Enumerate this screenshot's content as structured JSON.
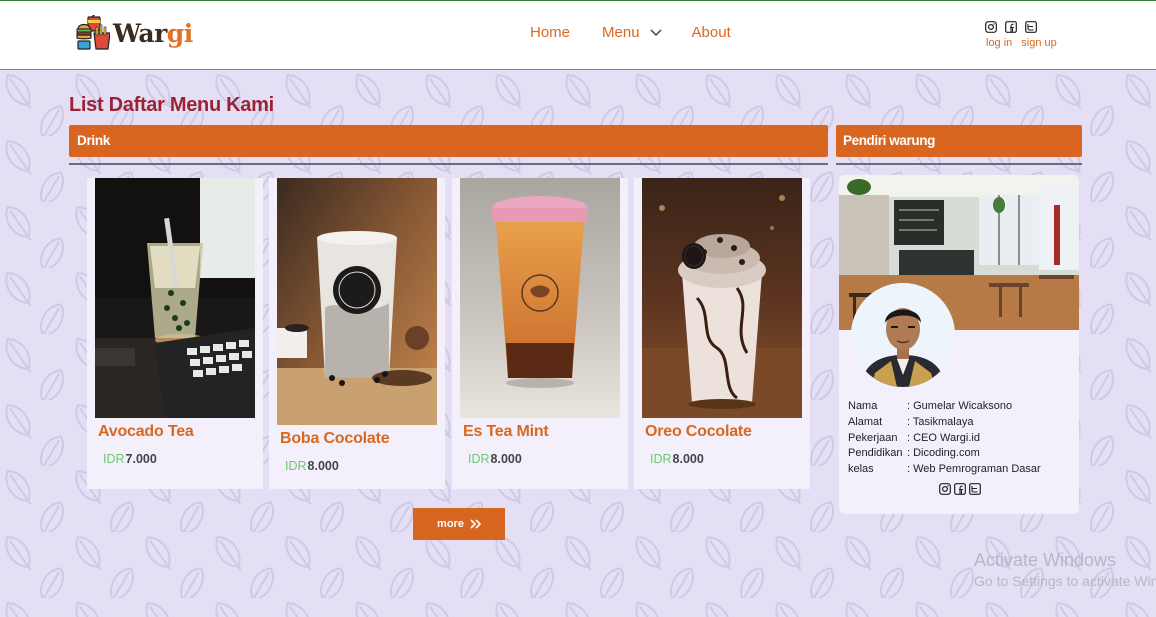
{
  "header": {
    "brand": {
      "prefix": "War",
      "suffix": "gi"
    },
    "nav": {
      "home": "Home",
      "menu": "Menu",
      "about": "About"
    },
    "auth": {
      "login": "log in",
      "signup": "sign up"
    }
  },
  "main": {
    "title": "List Daftar Menu Kami",
    "section_label": "Drink",
    "products": [
      {
        "name": "Avocado Tea",
        "currency": "IDR",
        "price": "7.000"
      },
      {
        "name": "Boba Cocolate",
        "currency": "IDR",
        "price": "8.000"
      },
      {
        "name": "Es Tea Mint",
        "currency": "IDR",
        "price": "8.000"
      },
      {
        "name": "Oreo Cocolate",
        "currency": "IDR",
        "price": "8.000"
      }
    ],
    "more_label": "more"
  },
  "sidebar": {
    "title": "Pendiri warung",
    "profile": [
      {
        "key": "Nama",
        "value": ": Gumelar Wicaksono"
      },
      {
        "key": "Alamat",
        "value": ": Tasikmalaya"
      },
      {
        "key": "Pekerjaan",
        "value": ": CEO Wargi.id"
      },
      {
        "key": "Pendidikan",
        "value": ": Dicoding.com"
      },
      {
        "key": "kelas",
        "value": ": Web Pemrograman Dasar"
      }
    ]
  },
  "watermark": {
    "line1": "Activate Windows",
    "line2": "Go to Settings to activate Windows."
  },
  "colors": {
    "accent": "#d86620",
    "title": "#9b2335",
    "background": "#e4dff4",
    "card": "#f3f0fb",
    "currency": "#6fc76f"
  },
  "icons": [
    "instagram-icon",
    "facebook-icon",
    "twitter-icon",
    "chevron-down-icon",
    "double-chevron-right-icon"
  ]
}
